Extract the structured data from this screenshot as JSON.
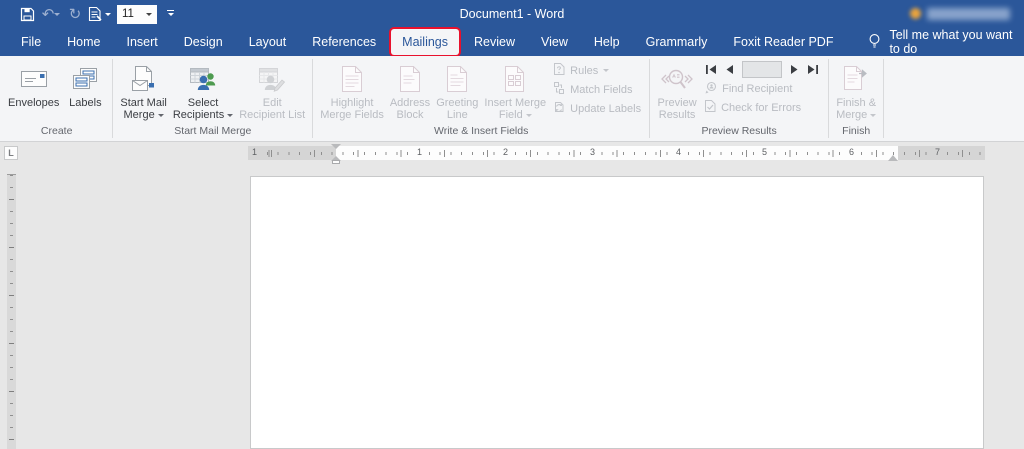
{
  "colors": {
    "titlebar_blue": "#2b579a",
    "annotation_red": "#e8112d",
    "ribbon_bg": "#f4f5f7",
    "icon_blue": "#3a6fb0",
    "icon_green": "#4e9b50",
    "disabled_text": "#b9bcc2"
  },
  "titlebar": {
    "title": "Document1  -  Word",
    "font_size_value": "11"
  },
  "tabs": [
    {
      "label": "File"
    },
    {
      "label": "Home"
    },
    {
      "label": "Insert"
    },
    {
      "label": "Design"
    },
    {
      "label": "Layout"
    },
    {
      "label": "References"
    },
    {
      "label": "Mailings",
      "selected": true
    },
    {
      "label": "Review"
    },
    {
      "label": "View"
    },
    {
      "label": "Help"
    },
    {
      "label": "Grammarly"
    },
    {
      "label": "Foxit Reader PDF"
    }
  ],
  "tell_me": "Tell me what you want to do",
  "ribbon": {
    "create": {
      "label": "Create",
      "envelopes": "Envelopes",
      "labels": "Labels"
    },
    "start_mail_merge": {
      "label": "Start Mail Merge",
      "start_mail_merge": [
        "Start Mail",
        "Merge"
      ],
      "select_recipients": [
        "Select",
        "Recipients"
      ],
      "edit_recipient_list": [
        "Edit",
        "Recipient List"
      ]
    },
    "write_insert": {
      "label": "Write & Insert Fields",
      "highlight_merge_fields": [
        "Highlight",
        "Merge Fields"
      ],
      "address_block": [
        "Address",
        "Block"
      ],
      "greeting_line": [
        "Greeting",
        "Line"
      ],
      "insert_merge_field": [
        "Insert Merge",
        "Field"
      ],
      "rules": "Rules",
      "match_fields": "Match Fields",
      "update_labels": "Update Labels"
    },
    "preview_results": {
      "label": "Preview Results",
      "preview_results": [
        "Preview",
        "Results"
      ],
      "record_number": "",
      "find_recipient": "Find Recipient",
      "check_for_errors": "Check for Errors"
    },
    "finish": {
      "label": "Finish",
      "finish_merge": [
        "Finish &",
        "Merge"
      ]
    }
  },
  "ruler": {
    "left_margin_mark": "1",
    "marks": [
      "1",
      "2",
      "3",
      "4",
      "5",
      "6",
      "7"
    ]
  }
}
